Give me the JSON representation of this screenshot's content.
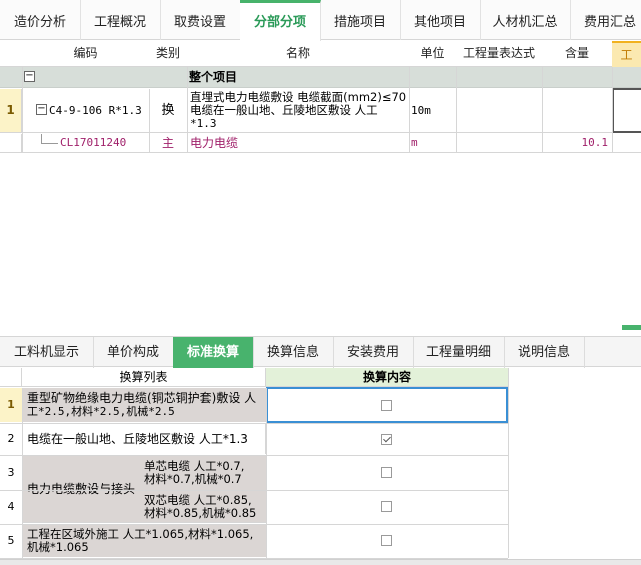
{
  "top_tabs": [
    "造价分析",
    "工程概况",
    "取费设置",
    "分部分项",
    "措施项目",
    "其他项目",
    "人材机汇总",
    "费用汇总"
  ],
  "upper_grid": {
    "headers": [
      "编码",
      "类别",
      "名称",
      "单位",
      "工程量表达式",
      "含量",
      "工"
    ],
    "group_row": {
      "toggle": "−",
      "label": "整个项目"
    },
    "rows": [
      {
        "num": "1",
        "toggle": "−",
        "code": "C4-9-106 R*1.3",
        "type": "换",
        "name_line1": "直埋式电力电缆敷设 电缆截面(mm2)≤70",
        "name_line2": "电缆在一般山地、丘陵地区敷设 人工",
        "name_line3": "*1.3",
        "unit": "10m",
        "qty_expr": "",
        "content": ""
      },
      {
        "num": "",
        "code": "CL17011240",
        "type": "主",
        "name": "电力电缆",
        "unit": "m",
        "content": "10.1"
      }
    ]
  },
  "bottom_tabs": [
    "工料机显示",
    "单价构成",
    "标准换算",
    "换算信息",
    "安装费用",
    "工程量明细",
    "说明信息"
  ],
  "lower_grid": {
    "headers": [
      "换算列表",
      "换算内容"
    ],
    "rows": [
      {
        "num": "1",
        "line1": "重型矿物绝缘电力电缆(铜芯铜护套)敷设 人",
        "line2": "工*2.5,材料*2.5,机械*2.5",
        "checked": false
      },
      {
        "num": "2",
        "line1": "电缆在一般山地、丘陵地区敷设 人工*1.3",
        "checked": true
      },
      {
        "num": "3",
        "line1": "单芯电缆 人工*0.7,",
        "line2": "材料*0.7,机械*0.7",
        "checked": false
      },
      {
        "num": "4",
        "line1": "双芯电缆 人工*0.85,",
        "line2": "材料*0.85,机械*0.85",
        "checked": false
      },
      {
        "num": "5",
        "line1": "工程在区域外施工 人工*1.065,材料*1.065,",
        "line2": "机械*1.065",
        "checked": false
      }
    ],
    "merged_group_label": "电力电缆敷设与接头"
  },
  "colors": {
    "accent_green": "#48b36d",
    "selected_border": "#3a8fd4",
    "header_green": "#e3f1d9",
    "pink_text": "#a0206a"
  }
}
